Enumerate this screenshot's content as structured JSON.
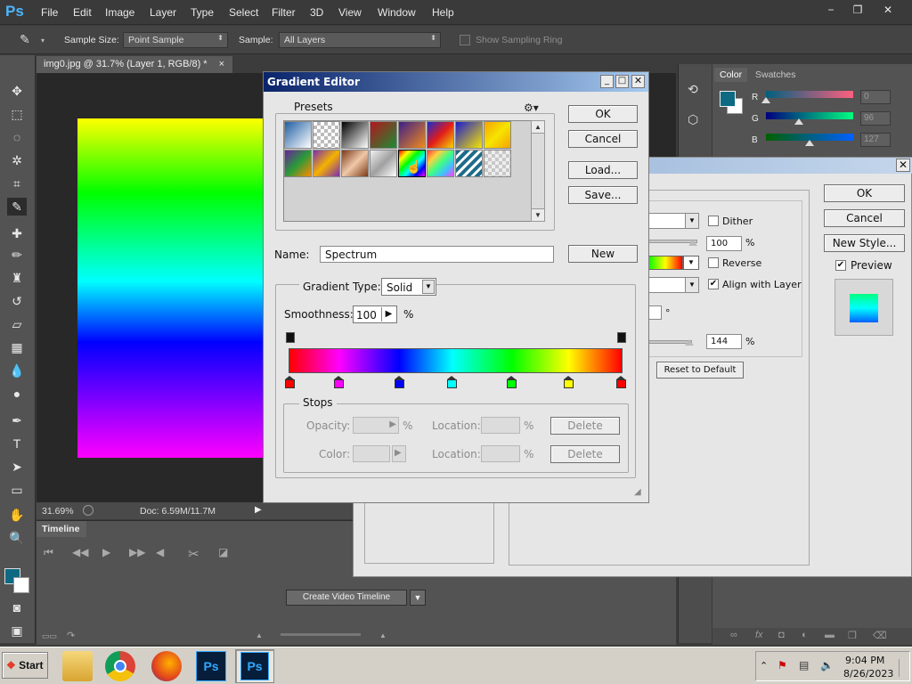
{
  "app": {
    "logo": "Ps",
    "menu": [
      "File",
      "Edit",
      "Image",
      "Layer",
      "Type",
      "Select",
      "Filter",
      "3D",
      "View",
      "Window",
      "Help"
    ],
    "window_controls": {
      "minimize": "−",
      "restore": "❐",
      "close": "✕"
    }
  },
  "options_bar": {
    "sample_size_label": "Sample Size:",
    "sample_size_value": "Point Sample",
    "sample_label": "Sample:",
    "sample_value": "All Layers",
    "show_sampling_ring": "Show Sampling Ring"
  },
  "document": {
    "tab_title": "img0.jpg @ 31.7% (Layer 1, RGB/8) *",
    "tab_close": "×",
    "zoom": "31.69%",
    "doc_info": "Doc: 6.59M/11.7M"
  },
  "timeline": {
    "tab": "Timeline",
    "create_button": "Create Video Timeline"
  },
  "color_panel": {
    "tabs": [
      "Color",
      "Swatches"
    ],
    "foreground_color": "#0e6a83",
    "channels": [
      {
        "label": "R",
        "value": "0"
      },
      {
        "label": "G",
        "value": "96"
      },
      {
        "label": "B",
        "value": "127"
      }
    ]
  },
  "gradient_overlay_dialog": {
    "ok": "OK",
    "cancel": "Cancel",
    "new_style": "New Style...",
    "preview": "Preview",
    "preview_checked": true,
    "dither": "Dither",
    "opacity_value": "100",
    "percent": "%",
    "reverse": "Reverse",
    "align_with_layer": "Align with Layer",
    "align_checked": true,
    "degree": "°",
    "scale_value": "144",
    "reset_to_default": "Reset to Default"
  },
  "gradient_editor": {
    "title": "Gradient Editor",
    "presets_label": "Presets",
    "ok": "OK",
    "cancel": "Cancel",
    "load": "Load...",
    "save": "Save...",
    "name_label": "Name:",
    "name_value": "Spectrum",
    "new": "New",
    "gradient_type_label": "Gradient Type:",
    "gradient_type_value": "Solid",
    "smoothness_label": "Smoothness:",
    "smoothness_value": "100",
    "percent": "%",
    "stops_label": "Stops",
    "opacity_label": "Opacity:",
    "color_label": "Color:",
    "location_label": "Location:",
    "delete": "Delete",
    "color_stops": [
      "#ff0000",
      "#ff00ff",
      "#0000ff",
      "#00ffff",
      "#00ff00",
      "#ffff00",
      "#ff0000"
    ]
  },
  "taskbar": {
    "start": "Start",
    "time": "9:04 PM",
    "date": "8/26/2023"
  }
}
